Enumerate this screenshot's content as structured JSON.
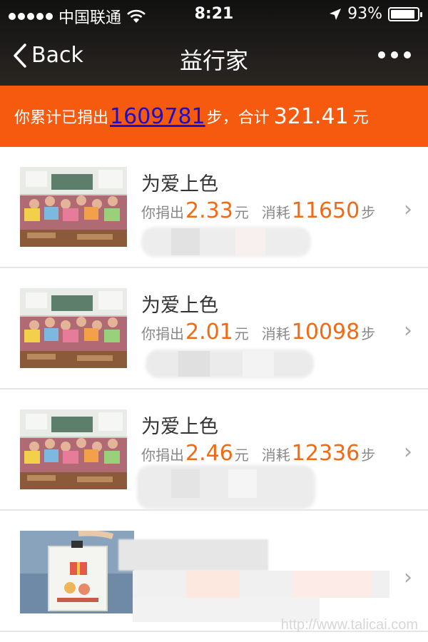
{
  "status_bar": {
    "carrier": "中国联通",
    "time": "8:21",
    "battery": "93%",
    "battery_level": 0.93
  },
  "nav": {
    "back_label": "Back",
    "title": "益行家"
  },
  "summary": {
    "prefix": "你累计已捐出",
    "steps": "1609781",
    "steps_unit": "步，合计",
    "amount": "321.41",
    "amount_unit": "元"
  },
  "items": [
    {
      "title": "为爱上色",
      "donated_label": "你捐出",
      "donated": "2.33",
      "currency": "元",
      "consumed_label": "消耗",
      "steps": "11650",
      "steps_unit": "步"
    },
    {
      "title": "为爱上色",
      "donated_label": "你捐出",
      "donated": "2.01",
      "currency": "元",
      "consumed_label": "消耗",
      "steps": "10098",
      "steps_unit": "步"
    },
    {
      "title": "为爱上色",
      "donated_label": "你捐出",
      "donated": "2.46",
      "currency": "元",
      "consumed_label": "消耗",
      "steps": "12336",
      "steps_unit": "步"
    }
  ],
  "watermark": "http://www.talicai.com",
  "colors": {
    "banner": "#f65a0f",
    "accent": "#f36a12",
    "link": "#1a10c8"
  }
}
